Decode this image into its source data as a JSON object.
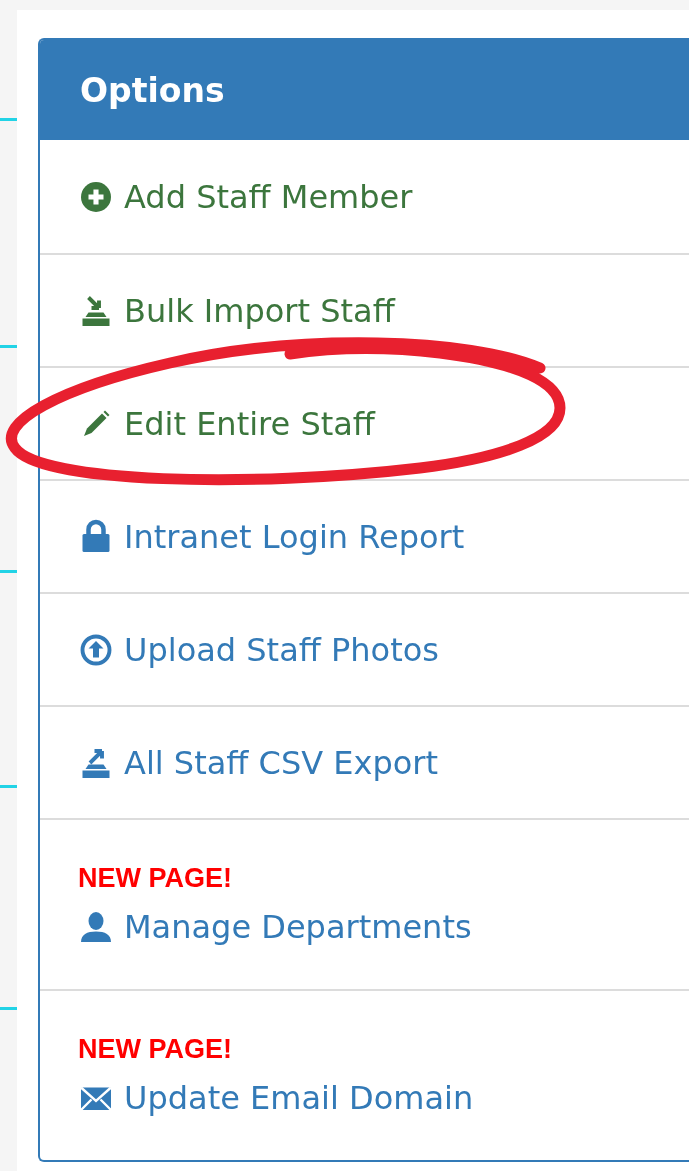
{
  "panel": {
    "title": "Options"
  },
  "items": [
    {
      "label": "Add Staff Member",
      "color": "#3c763d",
      "highlighted": false
    },
    {
      "label": "Bulk Import Staff",
      "color": "#3c763d",
      "highlighted": false
    },
    {
      "label": "Edit Entire Staff",
      "color": "#3c763d",
      "highlighted": true
    },
    {
      "label": "Intranet Login Report",
      "color": "#337ab7",
      "highlighted": false
    },
    {
      "label": "Upload Staff Photos",
      "color": "#337ab7",
      "highlighted": false
    },
    {
      "label": "All Staff CSV Export",
      "color": "#337ab7",
      "highlighted": false
    },
    {
      "label": "Manage Departments",
      "color": "#337ab7",
      "badge": "NEW PAGE!",
      "highlighted": false
    },
    {
      "label": "Update Email Domain",
      "color": "#337ab7",
      "badge": "NEW PAGE!",
      "highlighted": false
    }
  ]
}
